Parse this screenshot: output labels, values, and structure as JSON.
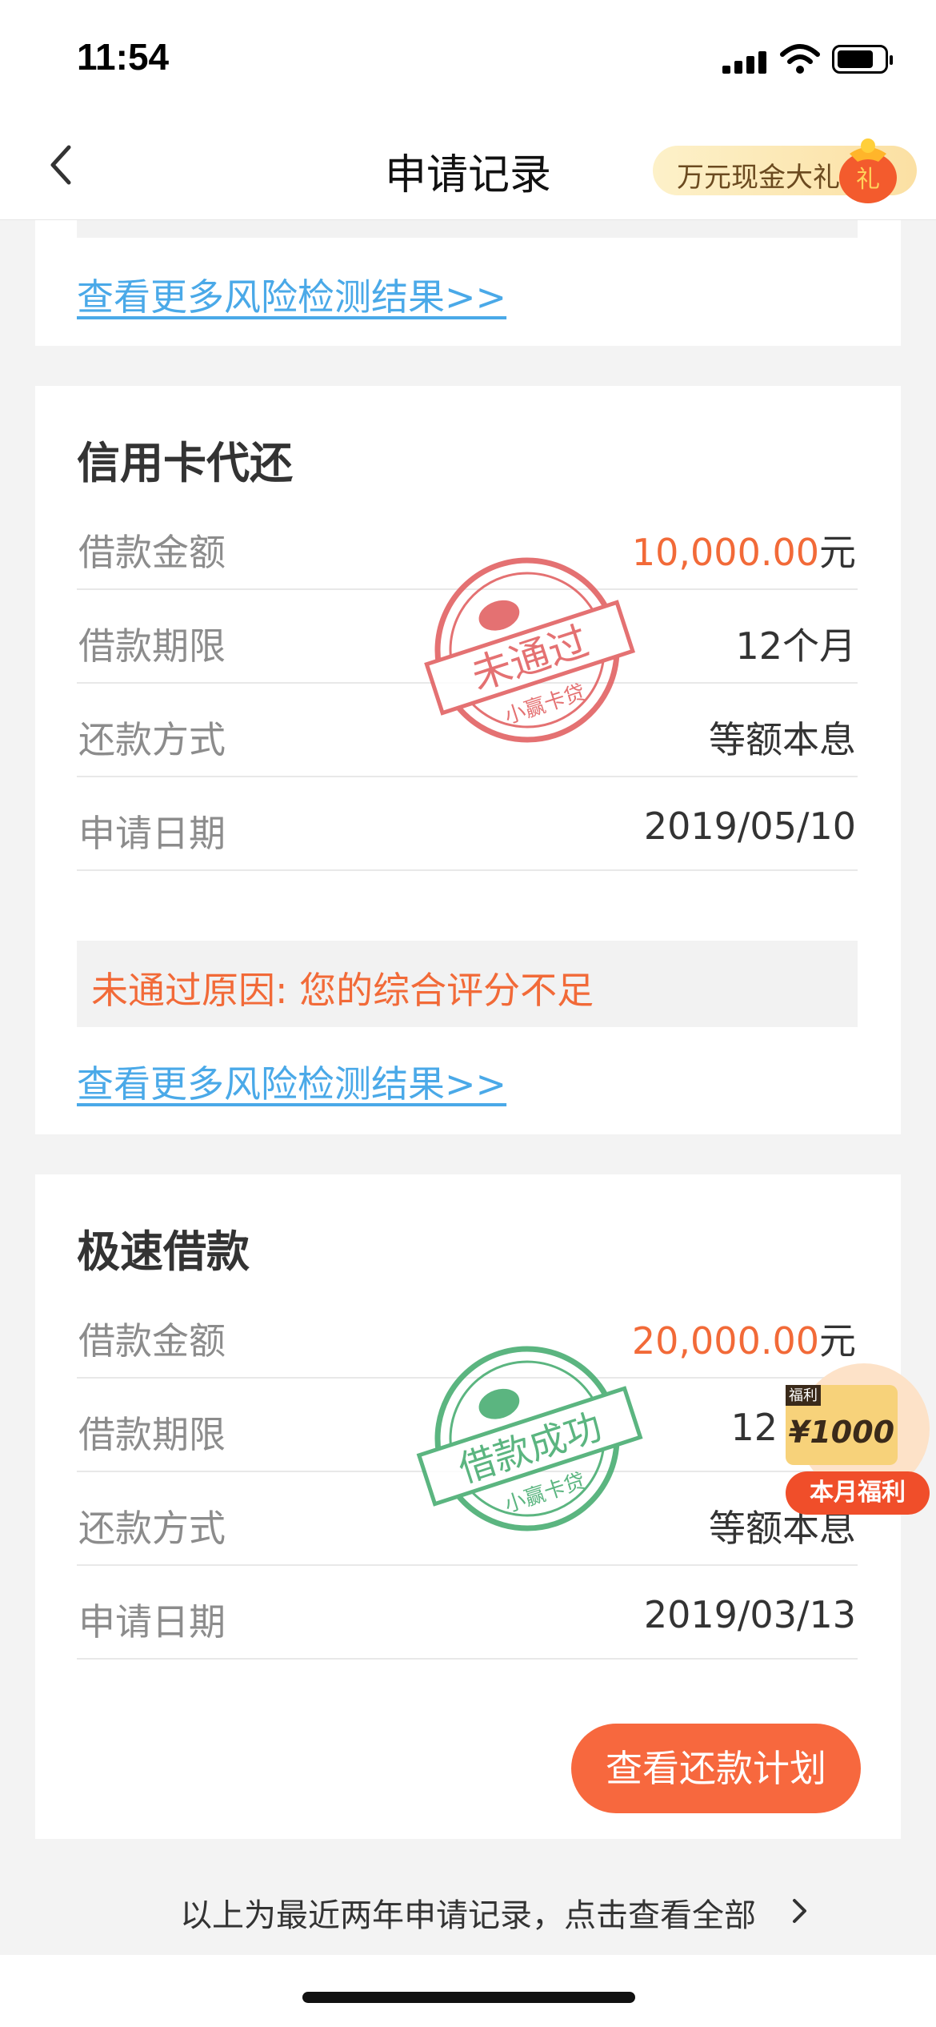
{
  "status_bar": {
    "time": "11:54"
  },
  "nav": {
    "title": "申请记录",
    "promo": "万元现金大礼",
    "bag_glyph": "礼"
  },
  "links": {
    "more_risk": "查看更多风险检测结果>>"
  },
  "cards": [
    {
      "title": "信用卡代还",
      "rows": [
        {
          "label": "借款金额",
          "number": "10,000.00",
          "unit": "元"
        },
        {
          "label": "借款期限",
          "value": "12个月"
        },
        {
          "label": "还款方式",
          "value": "等额本息"
        },
        {
          "label": "申请日期",
          "value": "2019/05/10"
        }
      ],
      "reason": "未通过原因: 您的综合评分不足",
      "stamp": {
        "main": "未通过",
        "sub": "小赢卡贷",
        "color": "#e0595a"
      }
    },
    {
      "title": "极速借款",
      "rows": [
        {
          "label": "借款金额",
          "number": "20,000.00",
          "unit": "元"
        },
        {
          "label": "借款期限",
          "value": "12"
        },
        {
          "label": "还款方式",
          "value": "等额本息"
        },
        {
          "label": "申请日期",
          "value": "2019/03/13"
        }
      ],
      "button": "查看还款计划",
      "stamp": {
        "main": "借款成功",
        "sub": "小赢卡贷",
        "color": "#3fa96a"
      }
    }
  ],
  "float_widget": {
    "tag": "福利",
    "amount": "¥1000",
    "label": "本月福利"
  },
  "footer": {
    "text": "以上为最近两年申请记录，点击查看全部"
  },
  "colors": {
    "accent": "#f7683e",
    "link": "#4aa9e8"
  }
}
